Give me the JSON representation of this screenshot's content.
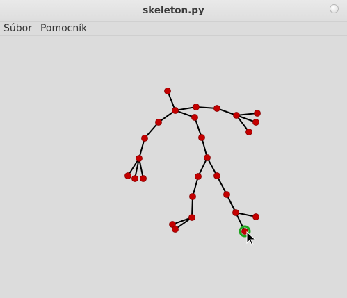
{
  "window": {
    "title": "skeleton.py"
  },
  "menu": {
    "items": [
      {
        "label": "Súbor"
      },
      {
        "label": "Pomocník"
      }
    ]
  },
  "colors": {
    "bone": "#000000",
    "joint": "#c40000",
    "joint_outline": "#8a0000",
    "selected_ring": "#1fa51f"
  },
  "selected_joint": 28
}
